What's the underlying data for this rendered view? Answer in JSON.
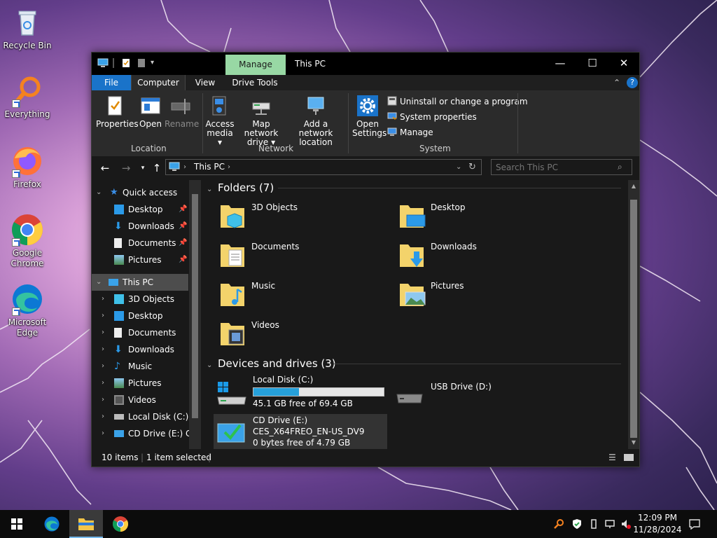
{
  "desktop": {
    "icons": [
      {
        "label": "Recycle Bin"
      },
      {
        "label": "Everything"
      },
      {
        "label": "Firefox"
      },
      {
        "label": "Google Chrome"
      },
      {
        "label": "Microsoft Edge"
      }
    ]
  },
  "window": {
    "title": "This PC",
    "manage_tab": "Manage",
    "controls": {
      "minimize": "—",
      "maximize": "☐",
      "close": "✕"
    },
    "tabs": [
      "File",
      "Computer",
      "View",
      "Drive Tools"
    ],
    "ribbon": {
      "location": {
        "label": "Location",
        "buttons": [
          "Properties",
          "Open",
          "Rename"
        ]
      },
      "network": {
        "label": "Network",
        "buttons": [
          {
            "line1": "Access",
            "line2": "media ▾"
          },
          {
            "line1": "Map network",
            "line2": "drive ▾"
          },
          {
            "line1": "Add a network",
            "line2": "location"
          }
        ]
      },
      "system": {
        "label": "System",
        "open_settings": {
          "line1": "Open",
          "line2": "Settings"
        },
        "links": [
          "Uninstall or change a program",
          "System properties",
          "Manage"
        ]
      }
    },
    "address": {
      "path": "This PC",
      "search_placeholder": "Search This PC"
    },
    "nav": {
      "quick_access": "Quick access",
      "quick_items": [
        "Desktop",
        "Downloads",
        "Documents",
        "Pictures"
      ],
      "this_pc": "This PC",
      "pc_items": [
        "3D Objects",
        "Desktop",
        "Documents",
        "Downloads",
        "Music",
        "Pictures",
        "Videos",
        "Local Disk (C:)",
        "CD Drive (E:) CES"
      ]
    },
    "content": {
      "folders_header": "Folders (7)",
      "folders": [
        "3D Objects",
        "Desktop",
        "Documents",
        "Downloads",
        "Music",
        "Pictures",
        "Videos"
      ],
      "devices_header": "Devices and drives (3)",
      "drives": [
        {
          "name": "Local Disk (C:)",
          "free": "45.1 GB free of 69.4 GB",
          "used_fraction": 0.35
        },
        {
          "name": "USB Drive (D:)"
        },
        {
          "name": "CD Drive (E:)",
          "label": "CES_X64FREO_EN-US_DV9",
          "free": "0 bytes free of 4.79 GB"
        }
      ]
    },
    "status": {
      "items": "10 items",
      "selected": "1 item selected"
    }
  },
  "taskbar": {
    "time": "12:09 PM",
    "date": "11/28/2024"
  },
  "colors": {
    "accent": "#1a73c9",
    "manage": "#98d8a4",
    "capacity": "#26a0da"
  }
}
